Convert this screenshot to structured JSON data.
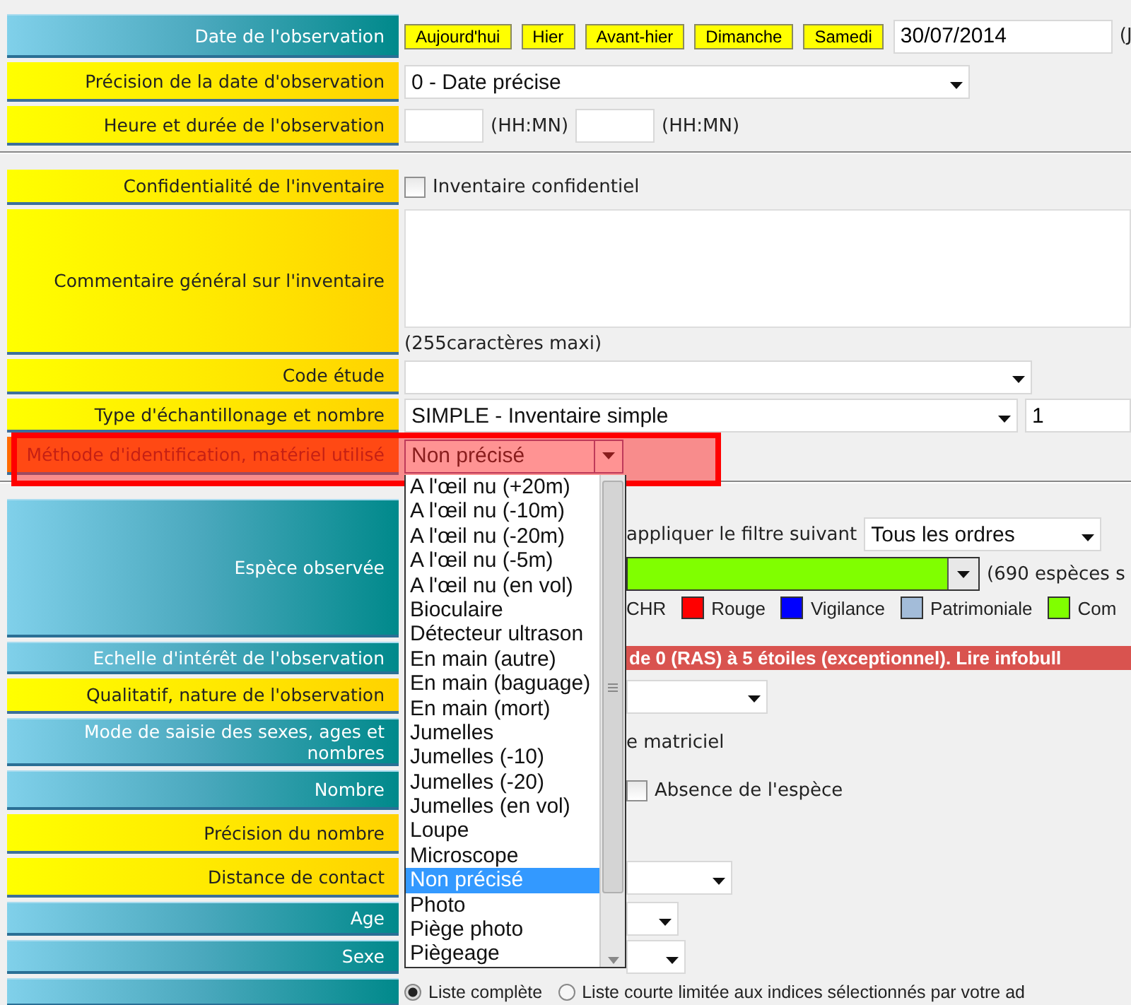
{
  "sections": [
    {
      "rows": [
        {
          "label": "Date de l'observation",
          "kind": "main",
          "lines": [
            [
              {
                "kind": "button",
                "text": "Aujourd'hui"
              },
              {
                "kind": "button",
                "text": "Hier"
              },
              {
                "kind": "button",
                "text": "Avant-hier"
              },
              {
                "kind": "button",
                "text": "Dimanche"
              },
              {
                "kind": "button",
                "text": "Samedi"
              },
              {
                "kind": "input",
                "value": "30/07/2014"
              },
              {
                "kind": "text",
                "text": "(J"
              }
            ]
          ]
        },
        {
          "label": "Précision de la date d'observation",
          "kind": "extra",
          "lines": [
            [
              {
                "kind": "select",
                "value": "0 - Date précise"
              }
            ]
          ]
        },
        {
          "label": "Heure et durée de l'observation",
          "kind": "extra",
          "lines": [
            [
              {
                "kind": "input"
              },
              {
                "kind": "text",
                "text": "(HH:MN)"
              },
              {
                "kind": "input"
              },
              {
                "kind": "text",
                "text": "(HH:MN)"
              }
            ]
          ]
        }
      ]
    },
    {
      "rows": [
        {
          "label": "Confidentialité de l'inventaire",
          "kind": "extra",
          "lines": [
            [
              {
                "kind": "checkbox",
                "label": "Inventaire confidentiel",
                "checked": false
              }
            ]
          ]
        },
        {
          "label": "Commentaire général sur l'inventaire",
          "kind": "extra",
          "lines": [
            [
              {
                "kind": "textarea"
              }
            ],
            [
              {
                "kind": "text",
                "text": "(255caractères maxi)"
              }
            ]
          ]
        },
        {
          "label": "Code étude",
          "kind": "extra",
          "lines": [
            [
              {
                "kind": "select"
              }
            ]
          ]
        },
        {
          "label": "Type d'échantillonage et nombre",
          "kind": "extra",
          "lines": [
            [
              {
                "kind": "select",
                "value": "SIMPLE - Inventaire simple"
              },
              {
                "kind": "input",
                "value": "1"
              }
            ]
          ]
        },
        {
          "label": "Méthode d'identification, matériel utilisé",
          "kind": "current",
          "highlighted": true,
          "lines": [
            [
              {
                "kind": "select",
                "value": "Non précisé",
                "open": true,
                "options": [
                  {
                    "label": "A l'œil nu (+20m)",
                    "selected": false
                  },
                  {
                    "label": "A l'œil nu (-10m)",
                    "selected": false
                  },
                  {
                    "label": "A l'œil nu (-20m)",
                    "selected": false
                  },
                  {
                    "label": "A l'œil nu (-5m)",
                    "selected": false
                  },
                  {
                    "label": "A l'œil nu (en vol)",
                    "selected": false
                  },
                  {
                    "label": "Bioculaire",
                    "selected": false
                  },
                  {
                    "label": "Détecteur ultrason",
                    "selected": false
                  },
                  {
                    "label": "En main (autre)",
                    "selected": false
                  },
                  {
                    "label": "En main (baguage)",
                    "selected": false
                  },
                  {
                    "label": "En main (mort)",
                    "selected": false
                  },
                  {
                    "label": "Jumelles",
                    "selected": false
                  },
                  {
                    "label": "Jumelles (-10)",
                    "selected": false
                  },
                  {
                    "label": "Jumelles (-20)",
                    "selected": false
                  },
                  {
                    "label": "Jumelles (en vol)",
                    "selected": false
                  },
                  {
                    "label": "Loupe",
                    "selected": false
                  },
                  {
                    "label": "Microscope",
                    "selected": false
                  },
                  {
                    "label": "Non précisé",
                    "selected": true
                  },
                  {
                    "label": "Photo",
                    "selected": false
                  },
                  {
                    "label": "Piège photo",
                    "selected": false
                  },
                  {
                    "label": "Piègeage",
                    "selected": false
                  }
                ]
              }
            ]
          ]
        }
      ]
    },
    {
      "rows": [
        {
          "label": "Espèce observée",
          "kind": "main",
          "lines": [
            [
              {
                "kind": "text",
                "text": "appliquer le filtre suivant"
              },
              {
                "kind": "select",
                "value": "Tous les ordres"
              }
            ],
            [
              {
                "kind": "select",
                "color": "#80ff00"
              },
              {
                "kind": "text",
                "text": "(690 espèces s"
              }
            ],
            [
              {
                "kind": "legend",
                "text": "CHR"
              },
              {
                "kind": "legend",
                "text": "Rouge",
                "color": "#ff0000"
              },
              {
                "kind": "legend",
                "text": "Vigilance",
                "color": "#0000ff"
              },
              {
                "kind": "legend",
                "text": "Patrimoniale",
                "color": "#a3bcd9"
              },
              {
                "kind": "legend",
                "text": "Com",
                "color": "#80ff00"
              }
            ]
          ]
        },
        {
          "label": "Echelle d'intérêt de l'observation",
          "kind": "main",
          "lines": [
            [
              {
                "kind": "banner",
                "text": "de 0 (RAS) à 5 étoiles (exceptionnel). Lire infobull"
              }
            ]
          ]
        },
        {
          "label": "Qualitatif, nature de l'observation",
          "kind": "extra",
          "lines": [
            [
              {
                "kind": "select"
              }
            ]
          ]
        },
        {
          "label": "Mode de saisie des sexes, ages et nombres",
          "kind": "main",
          "lines": [
            [
              {
                "kind": "text",
                "text": "e matriciel"
              }
            ]
          ]
        },
        {
          "label": "Nombre",
          "kind": "main",
          "lines": [
            [
              {
                "kind": "checkbox",
                "label": "Absence de l'espèce",
                "checked": false
              }
            ]
          ]
        },
        {
          "label": "Précision du nombre",
          "kind": "extra"
        },
        {
          "label": "Distance de contact",
          "kind": "extra",
          "lines": [
            [
              {
                "kind": "select"
              }
            ]
          ]
        },
        {
          "label": "Age",
          "kind": "main",
          "lines": [
            [
              {
                "kind": "select"
              }
            ]
          ]
        },
        {
          "label": "Sexe",
          "kind": "main",
          "lines": [
            [
              {
                "kind": "select"
              }
            ]
          ]
        },
        {
          "label": "",
          "kind": "main",
          "lines": [
            [
              {
                "kind": "radio",
                "label": "Liste complète",
                "selected": true
              },
              {
                "kind": "radio",
                "label": "Liste courte limitée aux indices sélectionnés par votre ad",
                "selected": false
              }
            ]
          ]
        }
      ]
    }
  ]
}
